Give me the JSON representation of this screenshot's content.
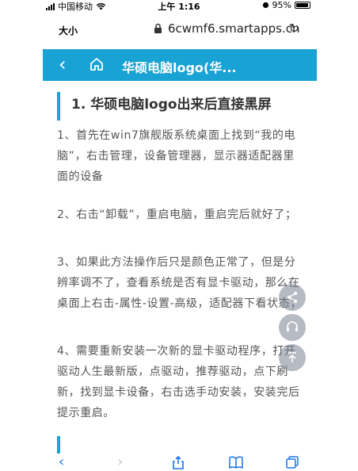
{
  "status_bar": {
    "carrier": "中国移动",
    "time": "上午 1:16",
    "battery": "95%"
  },
  "url_bar": {
    "text_size_label": "大小",
    "url": "6cwmf6.smartapps.cn"
  },
  "header": {
    "title": "华硕电脑logo(华..."
  },
  "article": {
    "section_title": "1. 华硕电脑logo出来后直接黑屏",
    "paragraphs": [
      "1、首先在win7旗舰版系统桌面上找到“我的电脑”，右击管理，设备管理器，显示器适配器里面的设备",
      "2、右击“卸载”，重启电脑，重启完后就好了；",
      "3、如果此方法操作后只是颜色正常了，但是分辨率调不了，查看系统是否有显卡驱动，那么在桌面上右击-属性-设置-高级，适配器下看状态；",
      "4、需要重新安装一次新的显卡驱动程序，打开驱动人生最新版，点驱动，推荐驱动，点下刷新，找到显卡设备，右击选手动安装，安装完后提示重启。"
    ]
  },
  "colors": {
    "accent": "#19a2d4",
    "toolbar_icon": "#1a73e8"
  }
}
